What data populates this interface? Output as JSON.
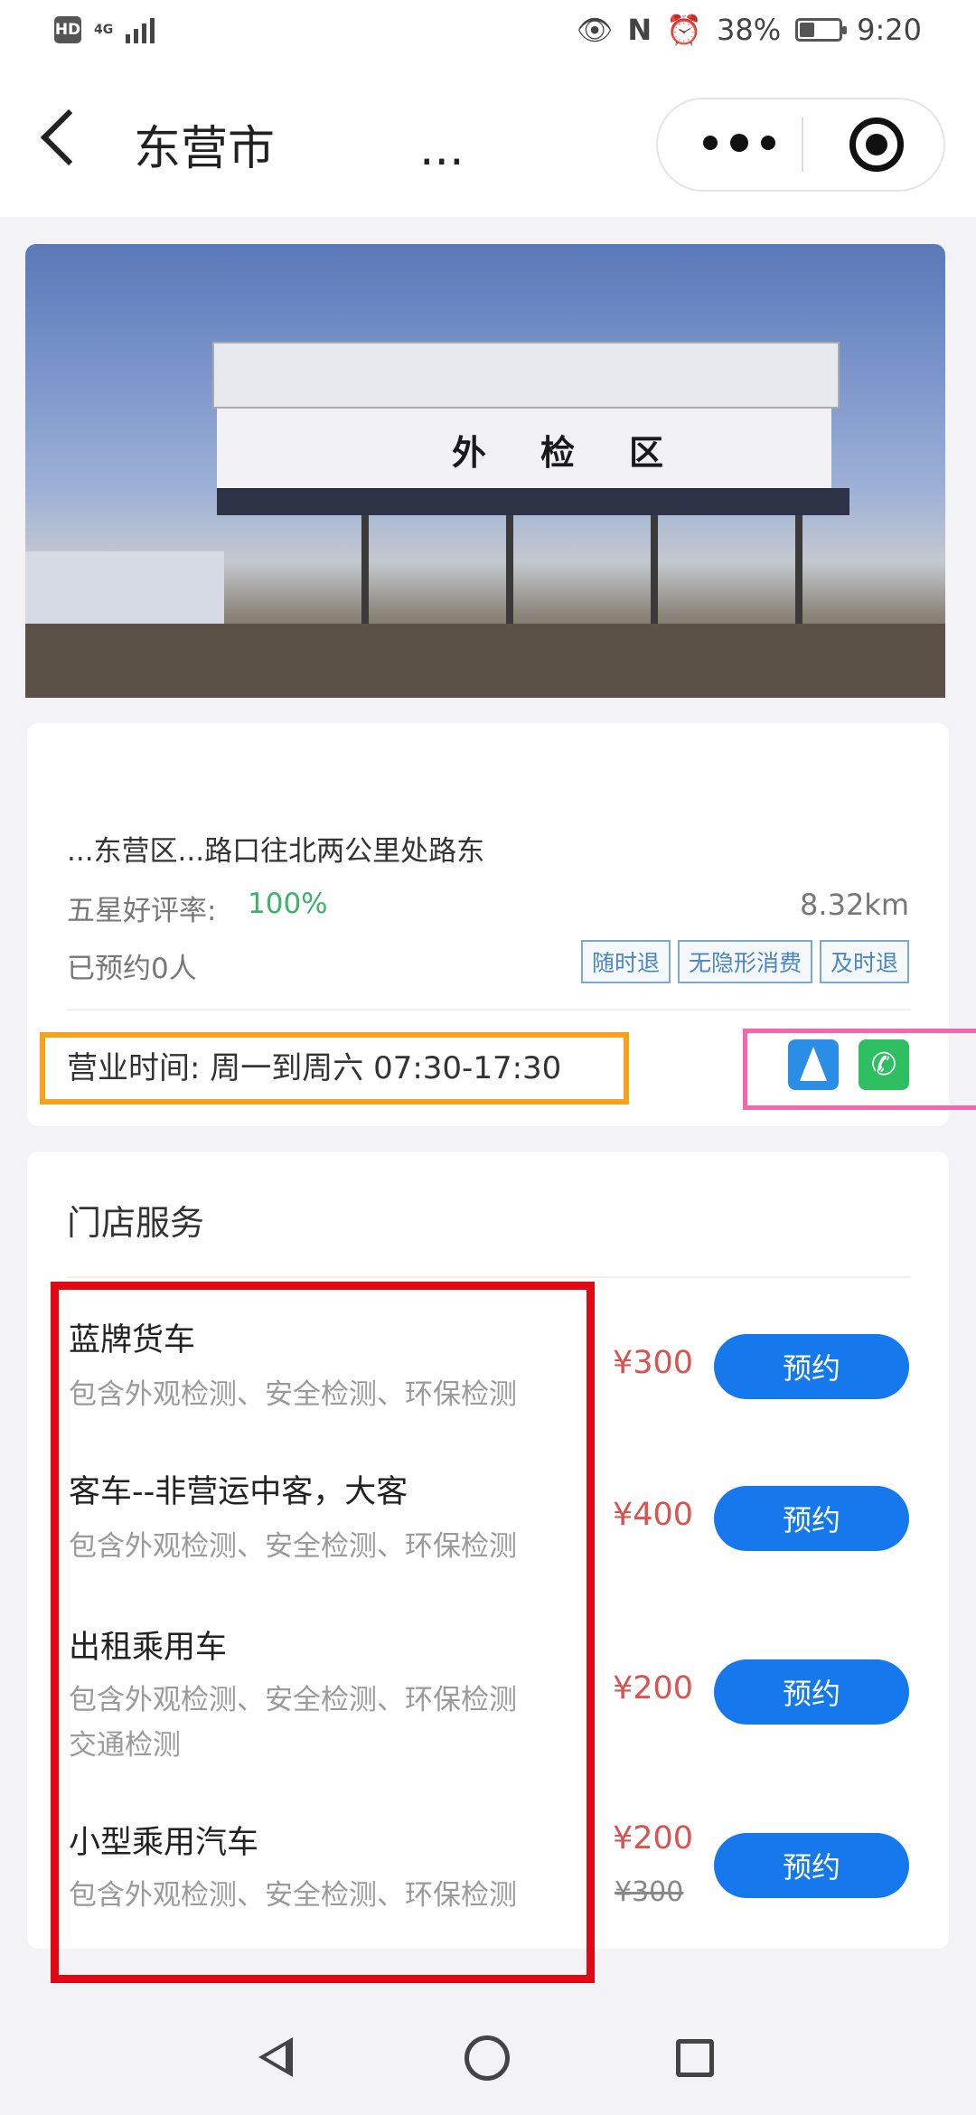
{
  "status_bar": {
    "hd": "HD",
    "network": "4G",
    "battery": "38%",
    "battery_level": 0.38,
    "time": "9:20"
  },
  "header": {
    "title": "东营市",
    "title_ellipsis": "..."
  },
  "hero": {
    "sign_text": "外检区"
  },
  "store": {
    "address": "...东营区...路口往北两公里处路东",
    "rating_label": "五星好评率:",
    "rating_value": "100%",
    "distance": "8.32km",
    "booked": "已预约0人",
    "tags": [
      "随时退",
      "无隐形消费",
      "及时退"
    ],
    "hours": "营业时间: 周一到周六 07:30-17:30"
  },
  "services": {
    "title": "门店服务",
    "book_label": "预约",
    "items": [
      {
        "name": "蓝牌货车",
        "desc": "包含外观检测、安全检测、环保检测",
        "desc2": "",
        "price": "¥300",
        "original_price": ""
      },
      {
        "name": "客车--非营运中客，大客",
        "desc": "包含外观检测、安全检测、环保检测",
        "desc2": "",
        "price": "¥400",
        "original_price": ""
      },
      {
        "name": "出租乘用车",
        "desc": "包含外观检测、安全检测、环保检测",
        "desc2": "交通检测",
        "price": "¥200",
        "original_price": ""
      },
      {
        "name": "小型乘用汽车",
        "desc": "包含外观检测、安全检测、环保检测",
        "desc2": "",
        "price": "¥200",
        "original_price": "¥300"
      }
    ]
  },
  "colors": {
    "accent_blue": "#1579ed",
    "price_red": "#d9534f",
    "rating_green": "#3cb36a",
    "annotation_orange": "#f7a21b",
    "annotation_pink": "#f267ad",
    "annotation_red": "#e30613"
  },
  "icons": {
    "navigate": "navigation-arrow-icon",
    "phone": "phone-icon"
  }
}
